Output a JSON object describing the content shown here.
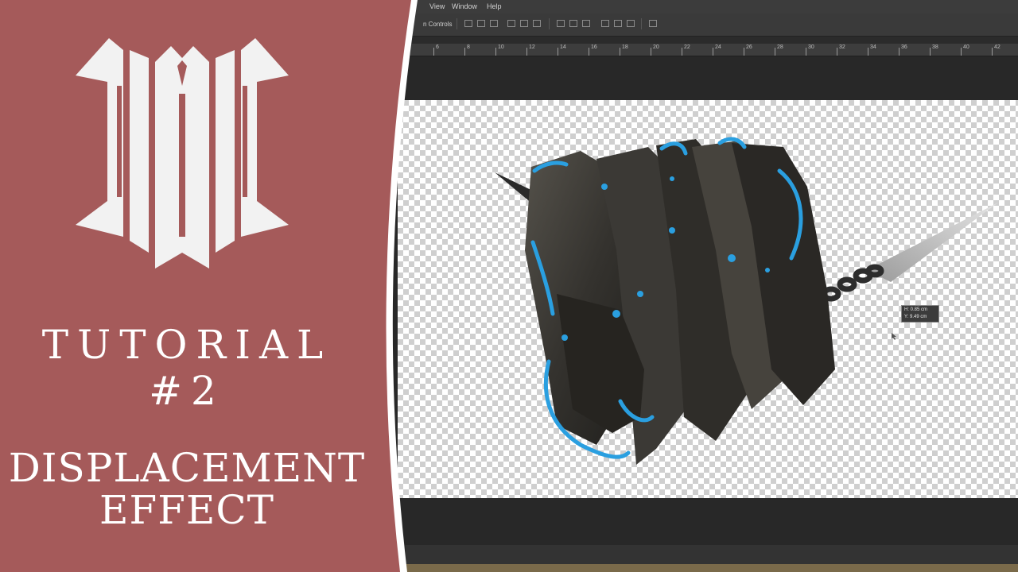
{
  "app": {
    "menu": [
      "View",
      "Window",
      "Help"
    ],
    "options_label": "n Controls",
    "ruler_labels": [
      "6",
      "8",
      "10",
      "12",
      "14",
      "16",
      "18",
      "20",
      "22",
      "24",
      "26",
      "28",
      "30",
      "32",
      "34",
      "36",
      "38",
      "40",
      "42"
    ],
    "tooltip": {
      "line1": "H: 0.85 cm",
      "line2": "Y: 9.49 cm"
    }
  },
  "brand": {
    "title": "TUTORIAL #2",
    "subtitle_line1": "DISPLACEMENT",
    "subtitle_line2": "EFFECT"
  },
  "colors": {
    "panel_bg": "#a55a5a",
    "panel_border": "#ffffff",
    "text": "#ffffff",
    "accent_glow": "#2a9fe0",
    "rock": "#3a3834"
  }
}
